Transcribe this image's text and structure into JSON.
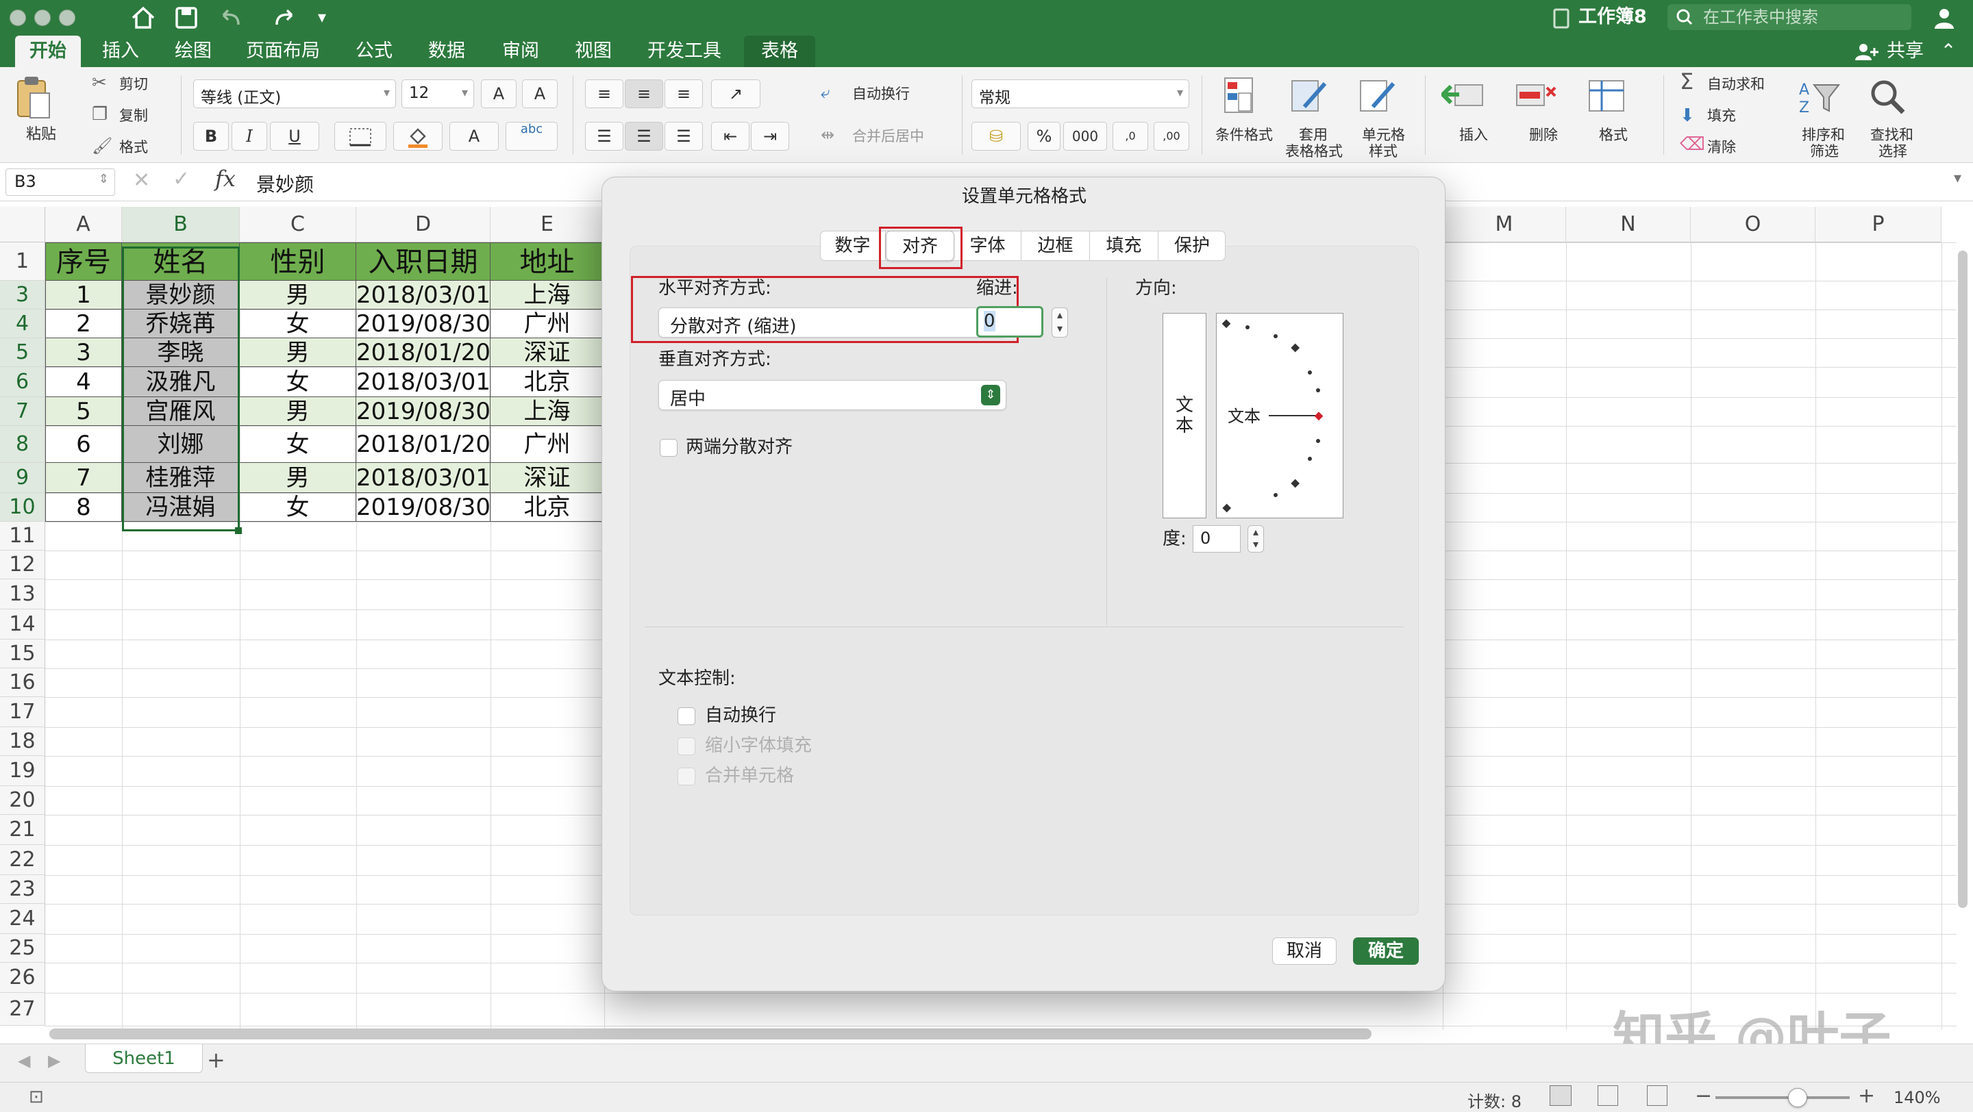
{
  "title": {
    "workbook": "工作簿8",
    "search_placeholder": "在工作表中搜索"
  },
  "tabs": [
    "开始",
    "插入",
    "绘图",
    "页面布局",
    "公式",
    "数据",
    "审阅",
    "视图",
    "开发工具",
    "表格"
  ],
  "share": "共享",
  "ribbon": {
    "paste": "粘贴",
    "cut": "剪切",
    "copy": "复制",
    "format_painter": "格式",
    "font_name": "等线 (正文)",
    "font_size": "12",
    "bold": "B",
    "italic": "I",
    "underline": "U",
    "font_color": "A",
    "grow_font": "A",
    "shrink_font": "A",
    "phonetic": "abc",
    "wrap_text": "自动换行",
    "merge_center": "合并后居中",
    "number_format": "常规",
    "percent": "%",
    "thousands": "000",
    "inc_decimal": ",0",
    "dec_decimal": ",00",
    "conditional_format": "条件格式",
    "table_format": [
      "套用",
      "表格格式"
    ],
    "cell_style": [
      "单元格",
      "样式"
    ],
    "insert": "插入",
    "delete": "删除",
    "format": "格式",
    "autosum": "自动求和",
    "fill": "填充",
    "clear": "清除",
    "sort_filter": [
      "排序和",
      "筛选"
    ],
    "find_select": [
      "查找和",
      "选择"
    ]
  },
  "formula_bar": {
    "name_box": "B3",
    "fx": "fx",
    "value": "景妙颜"
  },
  "columns": [
    "A",
    "B",
    "C",
    "D",
    "E",
    "M",
    "N",
    "O",
    "P"
  ],
  "rows": [
    "1",
    "3",
    "4",
    "5",
    "6",
    "7",
    "8",
    "9",
    "10",
    "11",
    "12",
    "13",
    "14",
    "15",
    "16",
    "17",
    "18",
    "19",
    "20",
    "21",
    "22",
    "23",
    "24",
    "25",
    "26",
    "27"
  ],
  "table": {
    "header": [
      "序号",
      "姓名",
      "性别",
      "入职日期",
      "地址"
    ],
    "rows": [
      [
        "1",
        "景妙颜",
        "男",
        "2018/03/01",
        "上海"
      ],
      [
        "2",
        "乔娆苒",
        "女",
        "2019/08/30",
        "广州"
      ],
      [
        "3",
        "李晓",
        "男",
        "2018/01/20",
        "深证"
      ],
      [
        "4",
        "汲雅凡",
        "女",
        "2018/03/01",
        "北京"
      ],
      [
        "5",
        "宫雁风",
        "男",
        "2019/08/30",
        "上海"
      ],
      [
        "6",
        "刘娜",
        "女",
        "2018/01/20",
        "广州"
      ],
      [
        "7",
        "桂雅萍",
        "男",
        "2018/03/01",
        "深证"
      ],
      [
        "8",
        "冯湛娟",
        "女",
        "2019/08/30",
        "北京"
      ]
    ]
  },
  "dialog": {
    "title": "设置单元格格式",
    "tabs": [
      "数字",
      "对齐",
      "字体",
      "边框",
      "填充",
      "保护"
    ],
    "horizontal_label": "水平对齐方式:",
    "horizontal_value": "分散对齐 (缩进)",
    "indent_label": "缩进:",
    "indent_value": "0",
    "vertical_label": "垂直对齐方式:",
    "vertical_value": "居中",
    "justify_distributed": "两端分散对齐",
    "orientation_label": "方向:",
    "vertical_text": [
      "文",
      "本"
    ],
    "orientation_text": "文本",
    "degree_label": "度:",
    "degree_value": "0",
    "text_control_label": "文本控制:",
    "wrap_text": "自动换行",
    "shrink_to_fit": "缩小字体填充",
    "merge_cells": "合并单元格",
    "cancel": "取消",
    "ok": "确定"
  },
  "sheet": {
    "tab": "Sheet1",
    "add": "+"
  },
  "status": {
    "count": "计数: 8",
    "zoom": "140%"
  },
  "watermark": "知乎 @叶子",
  "colors": {
    "brand": "#2d7a3e",
    "header_fill": "#6fae4e",
    "band_fill": "#e5f0dc",
    "highlight": "#d0202a"
  }
}
